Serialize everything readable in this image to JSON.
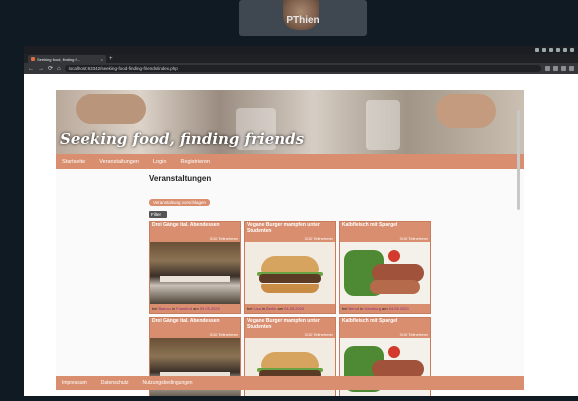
{
  "video_call": {
    "participant_name": "PThien"
  },
  "browser": {
    "tab_title": "Seeking food, finding f...",
    "tab_close": "×",
    "new_tab": "+",
    "url": "localhost:63342/seeking-food-finding-friends/index.php",
    "nav_back": "←",
    "nav_forward": "→",
    "nav_reload": "⟳",
    "nav_home": "⌂"
  },
  "site": {
    "banner_title": "Seeking food, finding friends",
    "nav": [
      "Startseite",
      "Veranstaltungen",
      "Login",
      "Registrieren"
    ],
    "page_title": "Veranstaltungen",
    "show_button": "Veranstaltung vorschlagen",
    "filter_button": "Filter",
    "footer_links": [
      "Impressum",
      "Datenschutz",
      "Nutzungsbedingungen"
    ]
  },
  "cards": [
    {
      "title": "Drei Gänge ital. Abendessen",
      "count": "3/10 Teilnehmer",
      "image": "dinner",
      "foot_prefix": "bei ",
      "host": "Bianca",
      "foot_mid": " in ",
      "city": "Frankfurt",
      "foot_suffix": " am ",
      "date": "09.05.2020"
    },
    {
      "title": "Vegane Burger mampfen unter Studenten",
      "count": "3/10 Teilnehmer",
      "image": "burger",
      "foot_prefix": "bei ",
      "host": "Lisa",
      "foot_mid": " in ",
      "city": "Berlin",
      "foot_suffix": " am ",
      "date": "04.05.2020"
    },
    {
      "title": "Kalbfleisch mit Spargel",
      "count": "3/10 Teilnehmer",
      "image": "steak",
      "foot_prefix": "bei ",
      "host": "Bernd",
      "foot_mid": " in ",
      "city": "Hamburg",
      "foot_suffix": " am ",
      "date": "04.05.2020"
    },
    {
      "title": "Drei Gänge ital. Abendessen",
      "count": "3/10 Teilnehmer",
      "image": "dinner",
      "foot_prefix": "",
      "host": "",
      "foot_mid": "",
      "city": "",
      "foot_suffix": "",
      "date": ""
    },
    {
      "title": "Vegane Burger mampfen unter Studenten",
      "count": "3/10 Teilnehmer",
      "image": "burger",
      "foot_prefix": "",
      "host": "",
      "foot_mid": "",
      "city": "",
      "foot_suffix": "",
      "date": ""
    },
    {
      "title": "Kalbfleisch mit Spargel",
      "count": "3/10 Teilnehmer",
      "image": "steak",
      "foot_prefix": "",
      "host": "",
      "foot_mid": "",
      "city": "",
      "foot_suffix": "",
      "date": ""
    }
  ],
  "colors": {
    "accent": "#d98f6f",
    "nav_text": "#ffffff",
    "highlight": "#8a2b7b"
  }
}
